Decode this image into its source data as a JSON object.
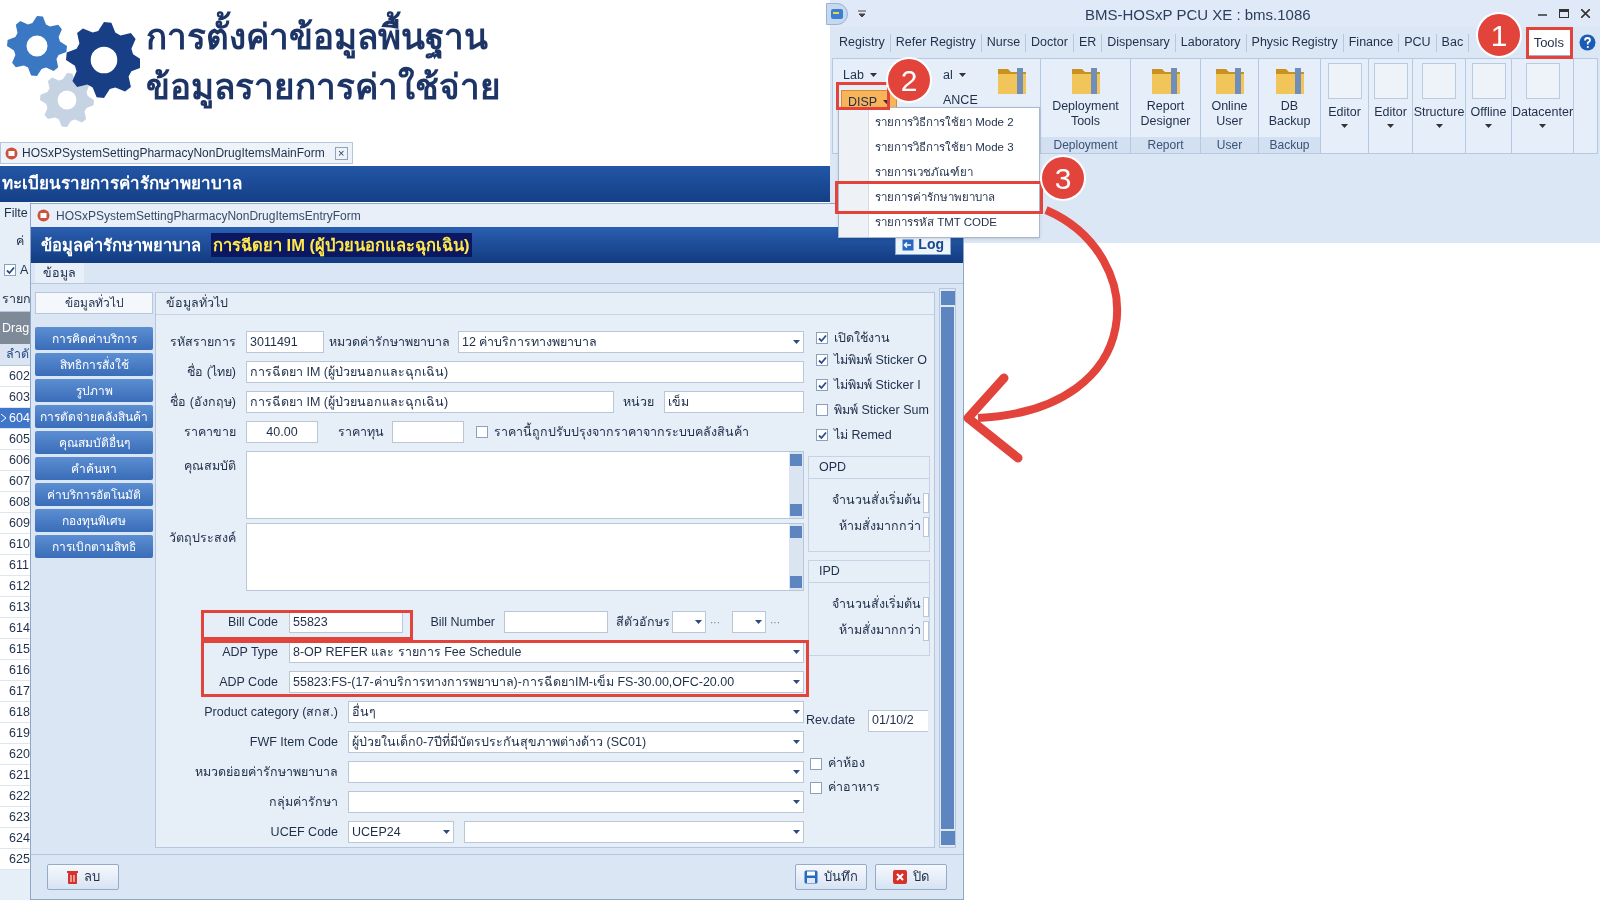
{
  "heading": {
    "lines": [
      "การตั้งค่าข้อมูลพื้นฐาน",
      "ข้อมูลรายการค่าใช้จ่าย"
    ]
  },
  "ribbon_window": {
    "title": "BMS-HOSxP PCU XE : bms.1086",
    "tabs": [
      {
        "label": "Registry",
        "selected": false
      },
      {
        "label": "Refer Registry",
        "selected": false
      },
      {
        "label": "Nurse",
        "selected": false
      },
      {
        "label": "Doctor",
        "selected": false
      },
      {
        "label": "ER",
        "selected": false
      },
      {
        "label": "Dispensary",
        "selected": false
      },
      {
        "label": "Laboratory",
        "selected": false
      },
      {
        "label": "Physic Registry",
        "selected": false
      },
      {
        "label": "Finance",
        "selected": false
      },
      {
        "label": "PCU",
        "selected": false
      },
      {
        "label": "Bac",
        "selected": false
      },
      {
        "label": "Tools",
        "selected": true
      }
    ],
    "small_buttons": [
      {
        "label": "Lab",
        "selected": false
      },
      {
        "label": "al",
        "selected": false
      },
      {
        "label": "DISP",
        "selected": true
      },
      {
        "label": "ANCE",
        "selected": false
      }
    ],
    "large_buttons": [
      {
        "kind": "folder"
      },
      {
        "kind": "folder",
        "label": "Deployment Tools",
        "group": "Deployment"
      },
      {
        "kind": "folder",
        "label": "Report Designer",
        "group": "Report"
      },
      {
        "kind": "folder",
        "label": "Online User",
        "group": "User"
      },
      {
        "kind": "folder",
        "label": "DB Backup",
        "group": "Backup"
      },
      {
        "kind": "blank",
        "label": "Editor"
      },
      {
        "kind": "blank",
        "label": "Editor"
      },
      {
        "kind": "blank",
        "label": "Structure"
      },
      {
        "kind": "blank",
        "label": "Offline"
      },
      {
        "kind": "blank",
        "label": "Datacenter"
      }
    ],
    "menu": [
      {
        "label": "รายการวิธีการใช้ยา Mode 2"
      },
      {
        "label": "รายการวิธีการใช้ยา Mode 3"
      },
      {
        "label": "รายการเวชภัณฑ์ยา"
      },
      {
        "label": "รายการค่ารักษาพยาบาล"
      },
      {
        "label": "รายการรหัส TMT CODE"
      }
    ]
  },
  "callouts": [
    "1",
    "2",
    "3"
  ],
  "main_form": {
    "tab": "HOSxPSystemSettingPharmacyNonDrugItemsMainForm",
    "close": "×",
    "header": "ทะเบียนรายการค่ารักษาพยาบาล",
    "fragments": {
      "filter": "Filte",
      "label": "ค่",
      "check": {
        "label": "A",
        "checked": true
      },
      "list_title": "รายก",
      "drag": "Drag",
      "column": "ลำดั"
    },
    "rows": [
      {
        "number": "602",
        "selected": false
      },
      {
        "number": "603",
        "selected": false
      },
      {
        "number": "604",
        "selected": true
      },
      {
        "number": "605",
        "selected": false
      },
      {
        "number": "606",
        "selected": false
      },
      {
        "number": "607",
        "selected": false
      },
      {
        "number": "608",
        "selected": false
      },
      {
        "number": "609",
        "selected": false
      },
      {
        "number": "610",
        "selected": false
      },
      {
        "number": "611",
        "selected": false
      },
      {
        "number": "612",
        "selected": false
      },
      {
        "number": "613",
        "selected": false
      },
      {
        "number": "614",
        "selected": false
      },
      {
        "number": "615",
        "selected": false
      },
      {
        "number": "616",
        "selected": false
      },
      {
        "number": "617",
        "selected": false
      },
      {
        "number": "618",
        "selected": false
      },
      {
        "number": "619",
        "selected": false
      },
      {
        "number": "620",
        "selected": false
      },
      {
        "number": "621",
        "selected": false
      },
      {
        "number": "622",
        "selected": false
      },
      {
        "number": "623",
        "selected": false
      },
      {
        "number": "624",
        "selected": false
      },
      {
        "number": "625",
        "selected": false
      }
    ]
  },
  "entry_form": {
    "title": "HOSxPSystemSettingPharmacyNonDrugItemsEntryForm",
    "header_label": "ข้อมูลค่ารักษาพยาบาล",
    "header_value": "การฉีดยา IM (ผู้ป่วยนอกและฉุกเฉิน)",
    "log_button": "Log",
    "tab": "ข้อมูล",
    "nav": [
      {
        "label": "ข้อมูลทั่วไป",
        "selected": true
      },
      {
        "label": "การคิดค่าบริการ",
        "selected": false
      },
      {
        "label": "สิทธิการสั่งใช้",
        "selected": false
      },
      {
        "label": "รูปภาพ",
        "selected": false
      },
      {
        "label": "การตัดจ่ายคลังสินค้า",
        "selected": false
      },
      {
        "label": "คุณสมบัติอื่นๆ",
        "selected": false
      },
      {
        "label": "คำค้นหา",
        "selected": false
      },
      {
        "label": "ค่าบริการอัตโนมัติ",
        "selected": false
      },
      {
        "label": "กองทุนพิเศษ",
        "selected": false
      },
      {
        "label": "การเบิกตามสิทธิ",
        "selected": false
      }
    ],
    "section_title": "ข้อมูลทั่วไป",
    "fields": {
      "item_code": {
        "label": "รหัสรายการ",
        "value": "3011491"
      },
      "category": {
        "label": "หมวดค่ารักษาพยาบาล",
        "value": "12 ค่าบริการทางพยาบาล"
      },
      "name_th": {
        "label": "ชื่อ (ไทย)",
        "value": "การฉีดยา IM (ผู้ป่วยนอกและฉุกเฉิน)"
      },
      "name_en": {
        "label": "ชื่อ (อังกฤษ)",
        "value": "การฉีดยา IM (ผู้ป่วยนอกและฉุกเฉิน)"
      },
      "unit": {
        "label": "หน่วย",
        "value": "เข็ม"
      },
      "sale_price": {
        "label": "ราคาขาย",
        "value": "40.00"
      },
      "cost_price": {
        "label": "ราคาทุน"
      },
      "price_from_stock": {
        "label": "ราคานี้ถูกปรับปรุงจากราคาจากระบบคลังสินค้า",
        "checked": false
      },
      "properties": {
        "label": "คุณสมบัติ"
      },
      "purpose": {
        "label": "วัตถุประสงค์"
      },
      "bill_code": {
        "label": "Bill Code",
        "value": "55823"
      },
      "bill_number": {
        "label": "Bill Number"
      },
      "font_color": {
        "label": "สีตัวอักษร",
        "buttons": [
          "···",
          "···"
        ]
      },
      "adp_type": {
        "label": "ADP Type",
        "value": "8-OP REFER และ รายการ Fee Schedule"
      },
      "adp_code": {
        "label": "ADP Code",
        "value": "55823:FS-(17-ค่าบริการทางการพยาบาล)-การฉีดยาIM-เข็ม FS-30.00,OFC-20.00"
      },
      "product_category": {
        "label": "Product category (สกส.)",
        "value": "อื่นๆ"
      },
      "fwf_item_code": {
        "label": "FWF Item Code",
        "value": "ผู้ป่วยในเด็ก0-7ปีที่มีบัตรประกันสุขภาพต่างด้าว (SC01)"
      },
      "sub_category": {
        "label": "หมวดย่อยค่ารักษาพยาบาล"
      },
      "treatment_group": {
        "label": "กลุ่มค่ารักษา"
      },
      "ucef_code": {
        "label": "UCEF Code",
        "value": "UCEP24"
      }
    },
    "options": [
      {
        "label": "เปิดใช้งาน",
        "checked": true
      },
      {
        "label": "ไม่พิมพ์ Sticker O",
        "checked": true
      },
      {
        "label": "ไม่พิมพ์ Sticker I",
        "checked": true
      },
      {
        "label": "พิมพ์ Sticker Sum",
        "checked": false
      },
      {
        "label": "ไม่ Remed",
        "checked": true
      }
    ],
    "opd": {
      "title": "OPD",
      "labels": [
        "จำนวนสั่งเริ่มต้น",
        "ห้ามสั่งมากกว่า"
      ]
    },
    "ipd": {
      "title": "IPD",
      "labels": [
        "จำนวนสั่งเริ่มต้น",
        "ห้ามสั่งมากกว่า"
      ]
    },
    "rev_date": {
      "label": "Rev.date",
      "value": "01/10/2"
    },
    "charges": [
      {
        "label": "ค่าห้อง",
        "checked": false
      },
      {
        "label": "ค่าอาหาร",
        "checked": false
      }
    ],
    "buttons": {
      "delete": "ลบ",
      "save": "บันทึก",
      "close": "ปิด"
    }
  }
}
